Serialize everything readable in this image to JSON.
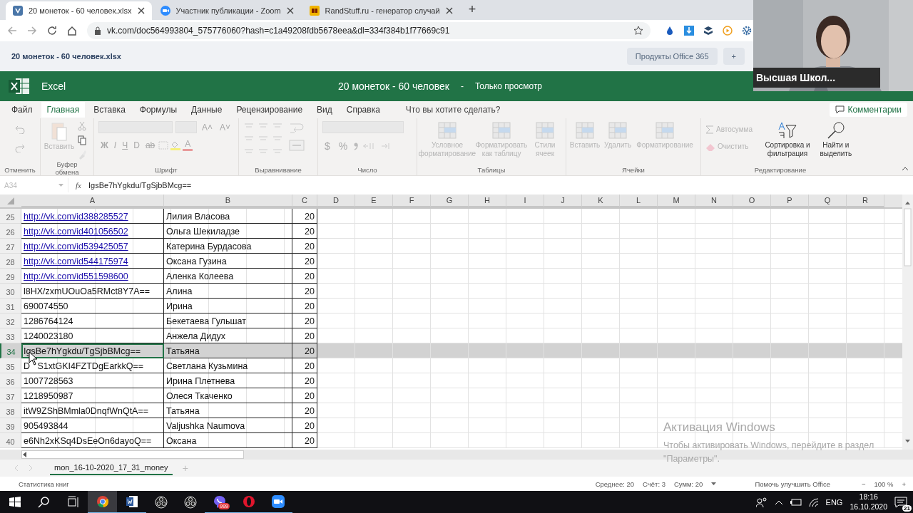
{
  "browser": {
    "tabs": [
      {
        "title": "20 монеток - 60 человек.xlsx",
        "selected": true
      },
      {
        "title": "Участник публикации - Zoom",
        "selected": false
      },
      {
        "title": "RandStuff.ru - генератор случай",
        "selected": false
      }
    ],
    "new_tab": "+",
    "address": "vk.com/doc564993804_575776060?hash=c1a49208fdb5678eea&dl=334f384b1f77669c91"
  },
  "doc_header": {
    "file_name": "20 монеток - 60 человек.xlsx",
    "products_button": "Продукты Office 365",
    "add_button": "+"
  },
  "excel_header": {
    "app_name": "Excel",
    "title": "20 монеток - 60 человек",
    "separator": "-",
    "mode": "Только просмотр"
  },
  "ribbon_tabs": [
    {
      "label": "Файл",
      "selected": false
    },
    {
      "label": "Главная",
      "selected": true
    },
    {
      "label": "Вставка",
      "selected": false
    },
    {
      "label": "Формулы",
      "selected": false
    },
    {
      "label": "Данные",
      "selected": false
    },
    {
      "label": "Рецензирование",
      "selected": false
    },
    {
      "label": "Вид",
      "selected": false
    },
    {
      "label": "Справка",
      "selected": false
    }
  ],
  "tell_me": {
    "placeholder": "Что вы хотите сделать?"
  },
  "comments_button": "Комментарии",
  "ribbon": {
    "groups": [
      {
        "label": "Отменить"
      },
      {
        "label": "Буфер обмена",
        "buttons": [
          {
            "label": "Вставить",
            "disabled": true
          }
        ]
      },
      {
        "label": "Шрифт"
      },
      {
        "label": "Выравнивание"
      },
      {
        "label": "Число"
      },
      {
        "label": "Таблицы",
        "buttons": [
          {
            "label": "Условное форматирование",
            "disabled": true
          },
          {
            "label": "Форматировать как таблицу",
            "disabled": true
          },
          {
            "label": "Стили ячеек",
            "disabled": true
          }
        ]
      },
      {
        "label": "Ячейки",
        "buttons": [
          {
            "label": "Вставить",
            "disabled": true
          },
          {
            "label": "Удалить",
            "disabled": true
          },
          {
            "label": "Форматирование",
            "disabled": true
          }
        ]
      },
      {
        "label": "Редактирование",
        "buttons": [
          {
            "label": "Автосумма",
            "disabled": true
          },
          {
            "label": "Очистить",
            "disabled": true
          },
          {
            "label": "Сортировка и фильтрация",
            "disabled": false
          },
          {
            "label": "Найти и выделить",
            "disabled": false
          }
        ]
      }
    ],
    "size_buttons": [
      "A˄",
      "A˅"
    ],
    "font_buttons": [
      "Ж",
      "I",
      "Ч",
      "D",
      "ab"
    ],
    "font_color": "A",
    "number_buttons": [
      "$",
      "%"
    ]
  },
  "formula_bar": {
    "name_box": "A34",
    "fx": "fx",
    "value": "IgsBe7hYgkdu/TgSjbBMcg=="
  },
  "sheet": {
    "columns": [
      "A",
      "B",
      "C",
      "D",
      "E",
      "F",
      "G",
      "H",
      "I",
      "J",
      "K",
      "L",
      "M",
      "N",
      "O",
      "P",
      "Q",
      "R"
    ],
    "rows": [
      {
        "number": "25",
        "a": "http://vk.com/id388285527",
        "b": "Лилия Власова",
        "c": "20",
        "link": true,
        "selected": false
      },
      {
        "number": "26",
        "a": "http://vk.com/id401056502",
        "b": "Ольга Шекиладзе",
        "c": "20",
        "link": true,
        "selected": false
      },
      {
        "number": "27",
        "a": "http://vk.com/id539425057",
        "b": "Катерина Бурдасова",
        "c": "20",
        "link": true,
        "selected": false
      },
      {
        "number": "28",
        "a": "http://vk.com/id544175974",
        "b": "Оксана Гузина",
        "c": "20",
        "link": true,
        "selected": false
      },
      {
        "number": "29",
        "a": "http://vk.com/id551598600",
        "b": "Аленка Колеева",
        "c": "20",
        "link": true,
        "selected": false
      },
      {
        "number": "30",
        "a": "l8HX/zxmUOuOa5RMct8Y7A==",
        "b": "Алина",
        "c": "20",
        "link": false,
        "selected": false
      },
      {
        "number": "31",
        "a": "690074550",
        "b": "Ирина",
        "c": "20",
        "link": false,
        "selected": false
      },
      {
        "number": "32",
        "a": "1286764124",
        "b": "Бекетаева Гульшат",
        "c": "20",
        "link": false,
        "selected": false
      },
      {
        "number": "33",
        "a": "1240023180",
        "b": "Анжела Дидух",
        "c": "20",
        "link": false,
        "selected": false
      },
      {
        "number": "34",
        "a": "IgsBe7hYgkdu/TgSjbBMcg==",
        "b": "Татьяна",
        "c": "20",
        "link": false,
        "selected": true
      },
      {
        "number": "35",
        "a": "D",
        "a2": "S1xtGKI4FZTDgEarkkQ==",
        "b": "Светлана Кузьмина",
        "c": "20",
        "link": false,
        "selected": false
      },
      {
        "number": "36",
        "a": "1007728563",
        "b": "Ирина Плетнева",
        "c": "20",
        "link": false,
        "selected": false
      },
      {
        "number": "37",
        "a": "1218950987",
        "b": "Олеся Ткаченко",
        "c": "20",
        "link": false,
        "selected": false
      },
      {
        "number": "38",
        "a": "itW9ZShBMmla0DnqfWnQtA==",
        "b": "Татьяна",
        "c": "20",
        "link": false,
        "selected": false
      },
      {
        "number": "39",
        "a": "905493844",
        "b": "Valjushka Naumova",
        "c": "20",
        "link": false,
        "selected": false
      },
      {
        "number": "40",
        "a": "e6Nh2xKSq4DsEeOn6dayoQ==",
        "b": "Оксана",
        "c": "20",
        "link": false,
        "selected": false
      }
    ]
  },
  "activation": {
    "title": "Активация Windows",
    "text": "Чтобы активировать Windows, перейдите в раздел \"Параметры\"."
  },
  "sheet_tabs": [
    {
      "label": "mon_16-10-2020_17_31_money",
      "selected": true
    }
  ],
  "add_sheet": "+",
  "status_bar": {
    "left": "Статистика книг",
    "average": "Среднее: 20",
    "count": "Счёт: 3",
    "sum": "Сумм: 20",
    "feedback": "Помочь улучшить Office",
    "zoom_out": "−",
    "zoom": "100 %",
    "zoom_in": "+"
  },
  "video": {
    "kind": "picture",
    "name": "Высшая Школ..."
  },
  "taskbar": {
    "viber_badge": "999",
    "language": "ENG",
    "time": "18:16",
    "date": "16.10.2020",
    "notifications": "21"
  }
}
